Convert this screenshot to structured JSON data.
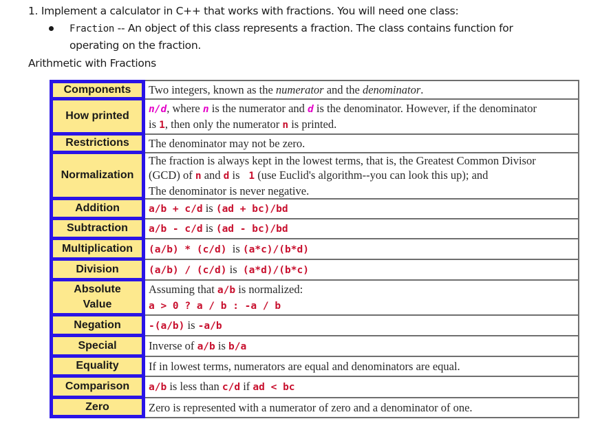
{
  "intro": {
    "line1": "1. Implement a calculator in C++ that works with fractions. You will need one class:",
    "bullet_code": "Fraction",
    "bullet_text": " -- An object of this class represents a fraction. The class contains function for",
    "bullet_cont": "operating on the fraction.",
    "section_title": "Arithmetic with Fractions"
  },
  "table": {
    "rows": [
      {
        "label": "Components",
        "parts": [
          {
            "t": "Two integers, known as the "
          },
          {
            "t": "numerator",
            "s": "i"
          },
          {
            "t": " and the "
          },
          {
            "t": "denominator",
            "s": "i"
          },
          {
            "t": "."
          }
        ]
      },
      {
        "label": "How printed",
        "parts": [
          {
            "t": "n/d",
            "s": "m"
          },
          {
            "t": ", where "
          },
          {
            "t": "n",
            "s": "m"
          },
          {
            "t": " is the numerator and "
          },
          {
            "t": "d",
            "s": "m"
          },
          {
            "t": " is the denominator. However, if the denominator"
          },
          {
            "br": true
          },
          {
            "t": "is "
          },
          {
            "t": "1",
            "s": "c"
          },
          {
            "t": ", then only the numerator "
          },
          {
            "t": "n",
            "s": "c"
          },
          {
            "t": " is printed."
          }
        ]
      },
      {
        "label": "Restrictions",
        "parts": [
          {
            "t": "The denominator may not be zero."
          }
        ]
      },
      {
        "label": "Normalization",
        "parts": [
          {
            "t": "The fraction is always kept in the lowest terms, that is, the Greatest Common Divisor"
          },
          {
            "br": true
          },
          {
            "t": "(GCD) of "
          },
          {
            "t": "n",
            "s": "c"
          },
          {
            "t": " and "
          },
          {
            "t": "d",
            "s": "c"
          },
          {
            "t": " is "
          },
          {
            "t": " 1",
            "s": "c"
          },
          {
            "t": " (use Euclid's algorithm--you can look this up); and"
          },
          {
            "br": true
          },
          {
            "t": "The denominator is never negative."
          }
        ]
      },
      {
        "label": "Addition",
        "parts": [
          {
            "t": "a/b + c/d",
            "s": "c"
          },
          {
            "t": " is "
          },
          {
            "t": "(ad + bc)/bd",
            "s": "c"
          }
        ]
      },
      {
        "label": "Subtraction",
        "parts": [
          {
            "t": "a/b - c/d",
            "s": "c"
          },
          {
            "t": " is "
          },
          {
            "t": "(ad - bc)/bd",
            "s": "c"
          }
        ]
      },
      {
        "label": "Multiplication",
        "parts": [
          {
            "t": "(a/b) * (c/d)",
            "s": "c"
          },
          {
            "t": "  is "
          },
          {
            "t": "(a*c)/(b*d)",
            "s": "c"
          }
        ]
      },
      {
        "label": "Division",
        "parts": [
          {
            "t": "(a/b) / (c/d)",
            "s": "c"
          },
          {
            "t": " is  "
          },
          {
            "t": "(a*d)/(b*c)",
            "s": "c"
          }
        ]
      },
      {
        "label": "Absolute Value",
        "label_lines": [
          "Absolute",
          "Value"
        ],
        "parts": [
          {
            "t": "Assuming that "
          },
          {
            "t": "a/b",
            "s": "c"
          },
          {
            "t": " is normalized:"
          },
          {
            "br": true
          },
          {
            "t": "a > 0 ? a / b : -a / b",
            "s": "c"
          }
        ]
      },
      {
        "label": "Negation",
        "parts": [
          {
            "t": "-(a/b)",
            "s": "c"
          },
          {
            "t": " is "
          },
          {
            "t": "-a/b",
            "s": "c"
          }
        ]
      },
      {
        "label": "Special",
        "parts": [
          {
            "t": "Inverse of "
          },
          {
            "t": "a/b",
            "s": "c"
          },
          {
            "t": " is "
          },
          {
            "t": "b/a",
            "s": "c"
          }
        ]
      },
      {
        "label": "Equality",
        "parts": [
          {
            "t": "If in lowest terms, numerators are equal and denominators are equal."
          }
        ]
      },
      {
        "label": "Comparison",
        "parts": [
          {
            "t": "a/b",
            "s": "c"
          },
          {
            "t": " is less than "
          },
          {
            "t": "c/d",
            "s": "c"
          },
          {
            "t": " if "
          },
          {
            "t": "ad < bc",
            "s": "c"
          }
        ]
      },
      {
        "label": "Zero",
        "parts": [
          {
            "t": "Zero is represented with a numerator of zero and a denominator of one."
          }
        ]
      }
    ]
  },
  "colors": {
    "label_bg": "#fde98e",
    "label_border": "#2a14e6",
    "code_red": "#c8102e",
    "code_magenta": "#e400c8"
  }
}
